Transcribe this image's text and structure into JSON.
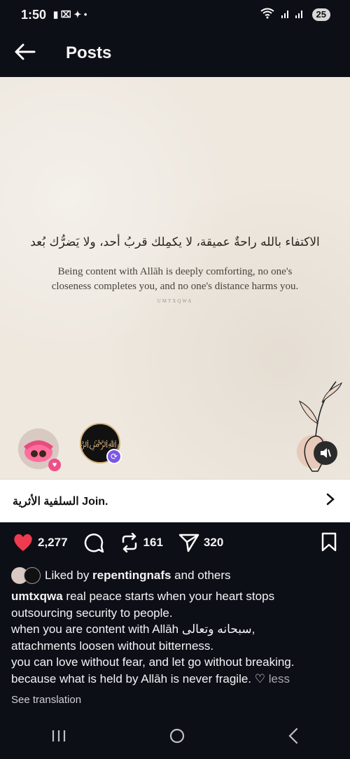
{
  "status_bar": {
    "time": "1:50",
    "battery": "25"
  },
  "header": {
    "title": "Posts"
  },
  "post": {
    "arabic_text": "الاكتفاء بالله راحةٌ عميقة، لا يكمِلك قربُ أحد، ولا يَضرُّك بُعد",
    "quote_line1": "Being content with Allāh is deeply comforting, no one's",
    "quote_line2": "closeness completes you, and no one's distance harms you.",
    "watermark": "UMTXQWA"
  },
  "join_bar": {
    "label": "السلفية الأثرية Join."
  },
  "actions": {
    "likes": "2,277",
    "reposts": "161",
    "shares": "320"
  },
  "liked_by": {
    "prefix": "Liked by ",
    "user": "repentingnafs",
    "suffix": " and others"
  },
  "caption": {
    "username": "umtxqwa",
    "line1": " real peace starts when your heart stops outsourcing security to people.",
    "line2": "when you are content with Allāh سبحانه وتعالى,",
    "line3": "attachments loosen without bitterness.",
    "line4": "you can love without fear, and let go without breaking.",
    "line5": "because what is held by Allāh is never fragile. ♡ ",
    "less": "less"
  },
  "translation": {
    "label": "See translation"
  },
  "colors": {
    "background": "#0d0f16",
    "like": "#ef3b4f",
    "repost_badge": "#7d56e8"
  }
}
